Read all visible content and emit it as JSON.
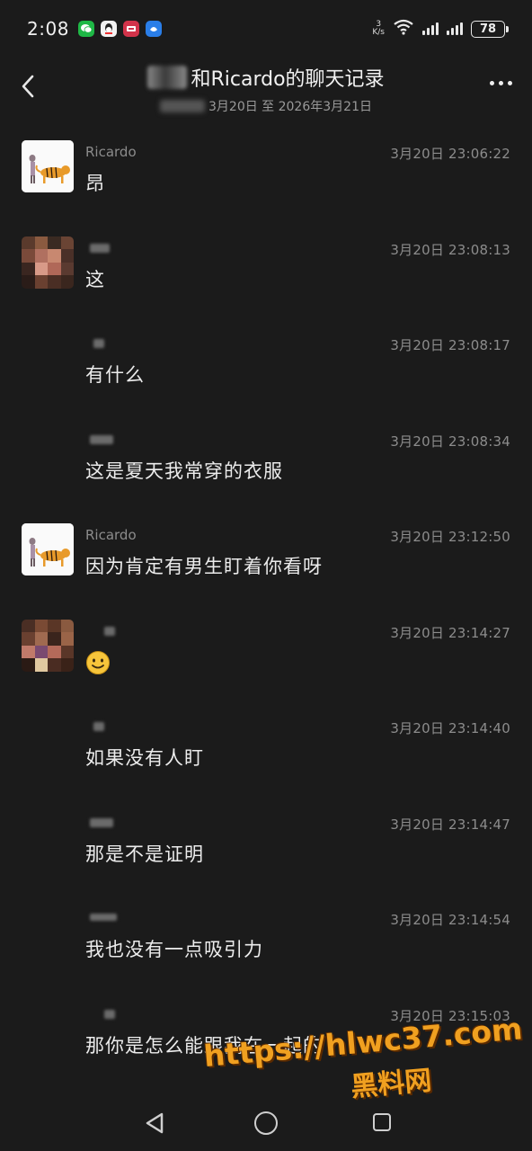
{
  "status_bar": {
    "time": "2:08",
    "speed_top": "3",
    "speed_unit": "K/s",
    "battery": "78",
    "notif_icons": [
      {
        "name": "wechat-icon",
        "color": "#1fb846"
      },
      {
        "name": "qq-icon",
        "color": "#f2f2f2"
      },
      {
        "name": "app-red-icon",
        "color": "#d2334a"
      },
      {
        "name": "app-blue-icon",
        "color": "#2a7ee8"
      }
    ]
  },
  "header": {
    "title": "和Ricardo的聊天记录",
    "subtitle": "3月20日 至 2026年3月21日"
  },
  "messages": [
    {
      "sender": "Ricardo",
      "avatar": "tiger",
      "time": "3月20日 23:06:22",
      "text": "昂"
    },
    {
      "sender": "",
      "avatar": "pixel-a",
      "time": "3月20日 23:08:13",
      "text": "这"
    },
    {
      "sender": "",
      "avatar": "none",
      "time": "3月20日 23:08:17",
      "text": "有什么"
    },
    {
      "sender": "",
      "avatar": "none",
      "time": "3月20日 23:08:34",
      "text": "这是夏天我常穿的衣服"
    },
    {
      "sender": "Ricardo",
      "avatar": "tiger",
      "time": "3月20日 23:12:50",
      "text": "因为肯定有男生盯着你看呀"
    },
    {
      "sender": "",
      "avatar": "pixel-b",
      "time": "3月20日 23:14:27",
      "text": "",
      "emoji": "smile-emoji"
    },
    {
      "sender": "",
      "avatar": "none",
      "time": "3月20日 23:14:40",
      "text": "如果没有人盯"
    },
    {
      "sender": "",
      "avatar": "none",
      "time": "3月20日 23:14:47",
      "text": "那是不是证明"
    },
    {
      "sender": "",
      "avatar": "none",
      "time": "3月20日 23:14:54",
      "text": "我也没有一点吸引力"
    },
    {
      "sender": "",
      "avatar": "none",
      "time": "3月20日 23:15:03",
      "text": "那你是怎么能跟我在一起的"
    }
  ],
  "watermark": {
    "url": "https://hlwc37.com",
    "name": "黑料网"
  }
}
